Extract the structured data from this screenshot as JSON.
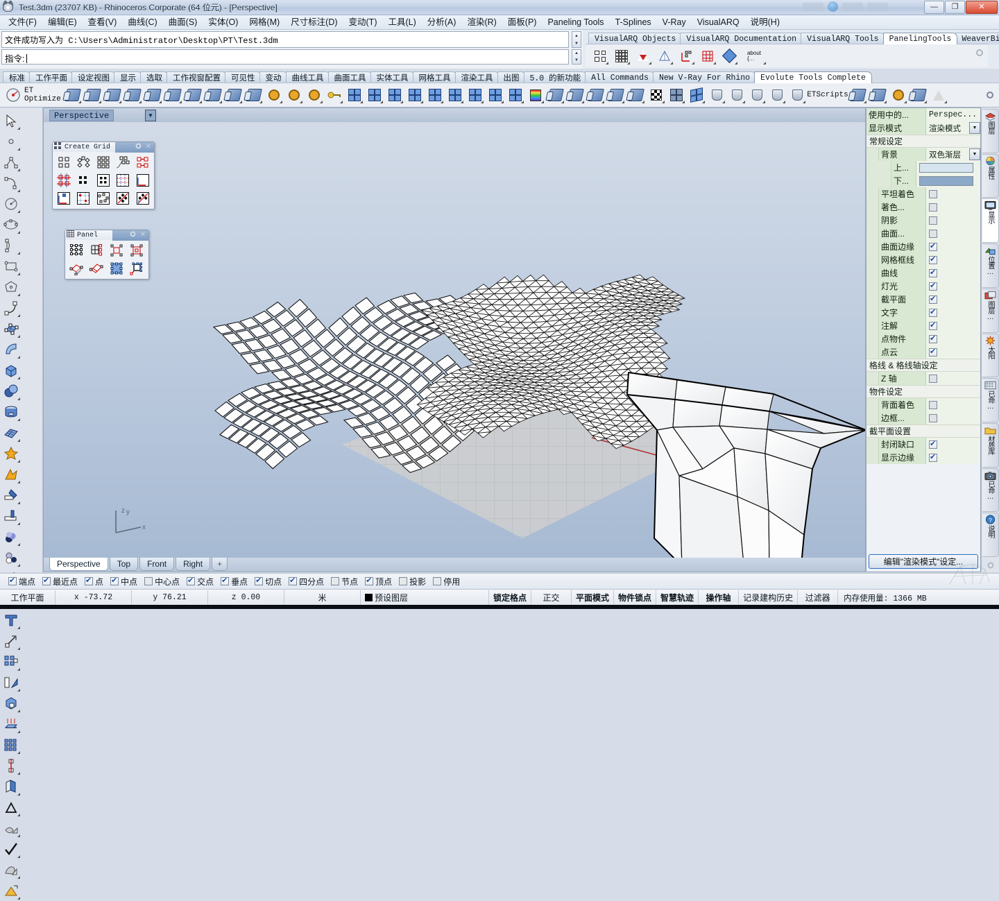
{
  "window": {
    "title": "Test.3dm (23707 KB) - Rhinoceros Corporate (64 位元) - [Perspective]",
    "app_icon": "rhino-logo-icon",
    "minimize": "—",
    "maximize": "❐",
    "close": "✕"
  },
  "menubar": {
    "items": [
      {
        "label": "文件(F)"
      },
      {
        "label": "编辑(E)"
      },
      {
        "label": "查看(V)"
      },
      {
        "label": "曲线(C)"
      },
      {
        "label": "曲面(S)"
      },
      {
        "label": "实体(O)"
      },
      {
        "label": "网格(M)"
      },
      {
        "label": "尺寸标注(D)"
      },
      {
        "label": "变动(T)"
      },
      {
        "label": "工具(L)"
      },
      {
        "label": "分析(A)"
      },
      {
        "label": "渲染(R)"
      },
      {
        "label": "面板(P)"
      },
      {
        "label": "Paneling Tools"
      },
      {
        "label": "T-Splines"
      },
      {
        "label": "V-Ray"
      },
      {
        "label": "VisualARQ"
      },
      {
        "label": "说明(H)"
      }
    ]
  },
  "command": {
    "history": "文件成功写入为 C:\\Users\\Administrator\\Desktop\\PT\\Test.3dm",
    "prompt_label": "指令:",
    "prompt_value": "",
    "scroll_up": "▲",
    "scroll_down": "▼"
  },
  "toolbar_tabs_top": {
    "tabs": [
      {
        "label": "VisualARQ Objects",
        "active": false
      },
      {
        "label": "VisualARQ Documentation",
        "active": false
      },
      {
        "label": "VisualARQ Tools",
        "active": false
      },
      {
        "label": "PanelingTools",
        "active": true
      },
      {
        "label": "WeaverBird",
        "active": false
      }
    ],
    "icons": [
      {
        "name": "ptgrid-dots-icon"
      },
      {
        "name": "ptgrid-array-icon"
      },
      {
        "name": "pt-triangle-icon"
      },
      {
        "name": "pt-mesh-icon"
      },
      {
        "name": "pt-pointgrid-icon"
      },
      {
        "name": "pt-redgrid-icon"
      },
      {
        "name": "pt-diamond-icon"
      },
      {
        "name": "pt-about-icon",
        "label": "about"
      }
    ],
    "gear": "gear-icon"
  },
  "toolbar_tabs_main": {
    "tabs": [
      {
        "label": "标准",
        "active": false
      },
      {
        "label": "工作平面",
        "active": false
      },
      {
        "label": "设定视图",
        "active": false
      },
      {
        "label": "显示",
        "active": false
      },
      {
        "label": "选取",
        "active": false
      },
      {
        "label": "工作视窗配置",
        "active": false
      },
      {
        "label": "可见性",
        "active": false
      },
      {
        "label": "变动",
        "active": false
      },
      {
        "label": "曲线工具",
        "active": false
      },
      {
        "label": "曲面工具",
        "active": false
      },
      {
        "label": "实体工具",
        "active": false
      },
      {
        "label": "网格工具",
        "active": false
      },
      {
        "label": "渲染工具",
        "active": false
      },
      {
        "label": "出图",
        "active": false
      },
      {
        "label": "5.0 的新功能",
        "active": false
      },
      {
        "label": "All Commands",
        "active": false
      },
      {
        "label": "New V-Ray For Rhino",
        "active": false
      },
      {
        "label": "Evolute Tools Complete",
        "active": true
      }
    ],
    "et_optimize_label": "ET Optimize",
    "etscripts_label": "ETScripts",
    "gear": "gear-icon"
  },
  "left_toolbar": {
    "icons": [
      "arrow-select-icon",
      "point-icon",
      "polyline-icon",
      "curve-icon",
      "circle-icon",
      "ellipse-icon",
      "arc-icon",
      "rectangle-icon",
      "polygon-icon",
      "curve-fillet-icon",
      "surface-from-points-icon",
      "sweep-surface-icon",
      "box-icon",
      "sphere-icon",
      "cylinder-icon",
      "surface-grid-icon",
      "boolean-union-icon",
      "explode-icon",
      "trim-icon",
      "split-icon",
      "blend-icon",
      "offset-icon",
      "fillet-curve-icon",
      "rebuild-curve-icon",
      "text-icon",
      "scale-icon",
      "array-icon",
      "mirror-icon",
      "group-icon",
      "rotate-icon",
      "extrude-icon",
      "contour-icon",
      "grid-array-icon",
      "section-icon",
      "unroll-icon",
      "check-icon",
      "mesh-icon",
      "render-icon"
    ]
  },
  "viewport": {
    "name": "Perspective",
    "dropdown_arrow": "▼",
    "tabs": [
      {
        "label": "Perspective",
        "active": true
      },
      {
        "label": "Top",
        "active": false
      },
      {
        "label": "Front",
        "active": false
      },
      {
        "label": "Right",
        "active": false
      },
      {
        "label": "+",
        "active": false
      }
    ],
    "axis": {
      "x": "x",
      "y": "y",
      "z": "z"
    },
    "floating_toolbars": [
      {
        "title": "Create Grid",
        "icon": "grid-dots-icon",
        "gear": "gear-icon",
        "close": "✕",
        "cells": [
          "grid-2x2-dots-icon",
          "grid-arc-dots-icon",
          "grid-array-dots-icon",
          "grid-curve-dots-icon",
          "grid-link-icon",
          "grid-cross-icon",
          "grid-solid-dots-icon",
          "grid-box-dots-icon",
          "grid-uv-dots-icon",
          "grid-uv-axes-icon",
          "grid-uv-fill-icon",
          "grid-polar-icon",
          "grid-scatter-icon",
          "grid-diamond-icon",
          "grid-diamond-axes-icon"
        ]
      },
      {
        "title": "Panel",
        "icon": "panel-grid-icon",
        "gear": "gear-icon",
        "close": "✕",
        "cells": [
          "panel-grid-icon",
          "panel-grid-red-icon",
          "panel-pts-icon",
          "panel-pts-red-icon",
          "panel-3d-icon",
          "panel-3d-stack-icon",
          "panel-blue-icon",
          "panel-single-icon"
        ]
      }
    ],
    "objects": [
      {
        "name": "quad-panel-surface",
        "type": "quad grid panels"
      },
      {
        "name": "triangulated-mesh-surface",
        "type": "triangular mesh"
      },
      {
        "name": "faceted-nurbs-surface",
        "type": "faceted quad surface"
      },
      {
        "name": "construction-plane-grid",
        "type": "grid"
      }
    ]
  },
  "right_panel": {
    "rows": [
      {
        "kind": "kv",
        "indent": 0,
        "label": "使用中的...",
        "value": "Perspec...",
        "control": "none"
      },
      {
        "kind": "kv",
        "indent": 0,
        "label": "显示模式",
        "value": "渲染模式",
        "control": "dropdown"
      },
      {
        "kind": "section",
        "label": "常规设定"
      },
      {
        "kind": "kv",
        "indent": 1,
        "label": "背景",
        "value": "双色渐层",
        "control": "dropdown"
      },
      {
        "kind": "swatch",
        "indent": 2,
        "label": "上...",
        "color": "#d6e4f0"
      },
      {
        "kind": "swatch",
        "indent": 2,
        "label": "下...",
        "color": "#8da9c8"
      },
      {
        "kind": "check",
        "indent": 1,
        "label": "平坦着色",
        "checked": false
      },
      {
        "kind": "check",
        "indent": 1,
        "label": "著色...",
        "checked": false
      },
      {
        "kind": "check",
        "indent": 1,
        "label": "阴影",
        "checked": false
      },
      {
        "kind": "check",
        "indent": 1,
        "label": "曲面...",
        "checked": false
      },
      {
        "kind": "check",
        "indent": 1,
        "label": "曲面边缘",
        "checked": true
      },
      {
        "kind": "check",
        "indent": 1,
        "label": "网格框线",
        "checked": true
      },
      {
        "kind": "check",
        "indent": 1,
        "label": "曲线",
        "checked": true
      },
      {
        "kind": "check",
        "indent": 1,
        "label": "灯光",
        "checked": true
      },
      {
        "kind": "check",
        "indent": 1,
        "label": "截平面",
        "checked": true
      },
      {
        "kind": "check",
        "indent": 1,
        "label": "文字",
        "checked": true
      },
      {
        "kind": "check",
        "indent": 1,
        "label": "注解",
        "checked": true
      },
      {
        "kind": "check",
        "indent": 1,
        "label": "点物件",
        "checked": true
      },
      {
        "kind": "check",
        "indent": 1,
        "label": "点云",
        "checked": true
      },
      {
        "kind": "section",
        "label": "格线 & 格线轴设定"
      },
      {
        "kind": "check",
        "indent": 1,
        "label": "Z 轴",
        "checked": false
      },
      {
        "kind": "section",
        "label": "物件设定"
      },
      {
        "kind": "check",
        "indent": 1,
        "label": "背面着色",
        "checked": false
      },
      {
        "kind": "check",
        "indent": 1,
        "label": "边框...",
        "checked": false
      },
      {
        "kind": "section",
        "label": "截平面设置"
      },
      {
        "kind": "check",
        "indent": 1,
        "label": "封闭缺口",
        "checked": true
      },
      {
        "kind": "check",
        "indent": 1,
        "label": "显示边缘",
        "checked": true
      }
    ],
    "edit_button": "编辑\"渲染模式\"设定..."
  },
  "right_tabs": {
    "items": [
      {
        "label": "图层",
        "icon": "layers-icon",
        "active": false
      },
      {
        "label": "属性",
        "icon": "properties-icon",
        "active": false
      },
      {
        "label": "显示",
        "icon": "display-monitor-icon",
        "active": true
      },
      {
        "label": "位置…",
        "icon": "position-icon",
        "active": false
      },
      {
        "label": "图层…",
        "icon": "layer-panel-icon",
        "active": false
      },
      {
        "label": "太阳",
        "icon": "sun-icon",
        "active": false
      },
      {
        "label": "已命…",
        "icon": "named-views-icon",
        "active": false
      },
      {
        "label": "材质库",
        "icon": "material-library-icon",
        "active": false
      },
      {
        "label": "已命…",
        "icon": "named-cplanes-icon",
        "active": false
      },
      {
        "label": "说明",
        "icon": "help-icon",
        "active": false
      }
    ],
    "gear": "gear-icon"
  },
  "osnap": {
    "items": [
      {
        "label": "端点",
        "checked": true
      },
      {
        "label": "最近点",
        "checked": true
      },
      {
        "label": "点",
        "checked": true
      },
      {
        "label": "中点",
        "checked": true
      },
      {
        "label": "中心点",
        "checked": false
      },
      {
        "label": "交点",
        "checked": true
      },
      {
        "label": "垂点",
        "checked": true
      },
      {
        "label": "切点",
        "checked": true
      },
      {
        "label": "四分点",
        "checked": true
      },
      {
        "label": "节点",
        "checked": false
      },
      {
        "label": "顶点",
        "checked": true
      },
      {
        "label": "投影",
        "checked": false
      },
      {
        "label": "停用",
        "checked": false
      }
    ]
  },
  "statusbar": {
    "cplane": "工作平面",
    "x": "x -73.72",
    "y": "y 76.21",
    "z": "z 0.00",
    "units": "米",
    "layer": "预设图层",
    "toggles": [
      {
        "label": "锁定格点",
        "bold": true
      },
      {
        "label": "正交",
        "bold": false
      },
      {
        "label": "平面模式",
        "bold": true
      },
      {
        "label": "物件锁点",
        "bold": true
      },
      {
        "label": "智慧轨迹",
        "bold": true
      },
      {
        "label": "操作轴",
        "bold": true
      },
      {
        "label": "记录建构历史",
        "bold": false
      },
      {
        "label": "过滤器",
        "bold": false
      }
    ],
    "memory": "内存使用量: 1366 MB"
  }
}
